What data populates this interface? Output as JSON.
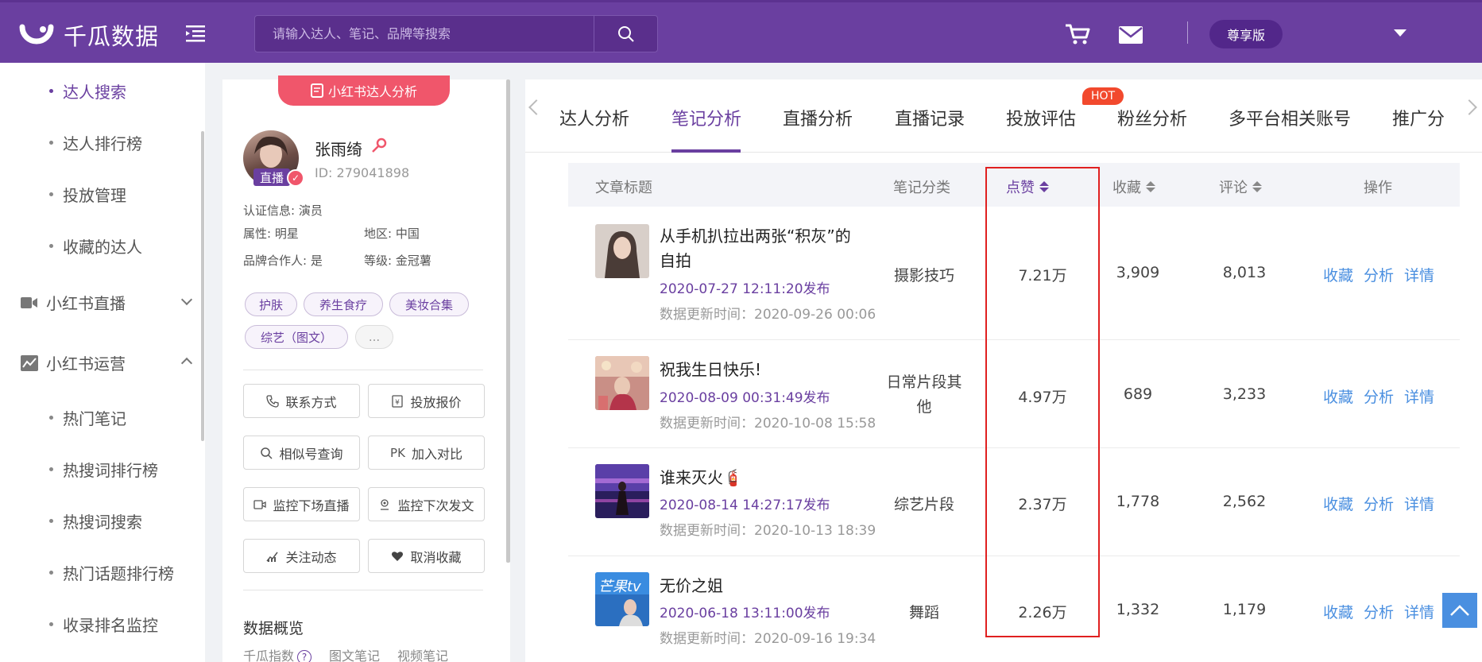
{
  "brand": {
    "name": "千瓜数据"
  },
  "search": {
    "placeholder": "请输入达人、笔记、品牌等搜索"
  },
  "header": {
    "plan_label": "尊享版"
  },
  "sidenav": {
    "sub_items_top": [
      "达人搜索",
      "达人排行榜",
      "投放管理",
      "收藏的达人"
    ],
    "group_live": "小红书直播",
    "group_ops": "小红书运营",
    "sub_items_ops": [
      "热门笔记",
      "热搜词排行榜",
      "热搜词搜索",
      "热门话题排行榜",
      "收录排名监控"
    ]
  },
  "profile": {
    "badge": "小红书达人分析",
    "live_tag": "直播",
    "name": "张雨绮",
    "id": "ID: 279041898",
    "cert": "认证信息: 演员",
    "attr": "属性: 明星",
    "region": "地区: 中国",
    "brand_partner": "品牌合作人: 是",
    "level": "等级: 金冠薯",
    "tags": [
      "护肤",
      "养生食疗",
      "美妆合集",
      "综艺（图文）",
      "..."
    ],
    "actions": [
      "联系方式",
      "投放报价",
      "相似号查询",
      "加入对比",
      "监控下场直播",
      "监控下次发文",
      "关注动态",
      "取消收藏"
    ],
    "section_title": "数据概览",
    "sub_tabs": [
      "千瓜指数",
      "图文笔记",
      "视频笔记"
    ]
  },
  "tabs": {
    "items": [
      "达人分析",
      "笔记分析",
      "直播分析",
      "直播记录",
      "投放评估",
      "粉丝分析",
      "多平台相关账号",
      "推广分"
    ],
    "hot": "HOT"
  },
  "table": {
    "headers": [
      "文章标题",
      "笔记分类",
      "点赞",
      "收藏",
      "评论",
      "操作"
    ],
    "rows": [
      {
        "title_line1": "从手机扒拉出两张“积灰”的",
        "title_line2": "自拍",
        "date": "2020-07-27 12:11:20发布",
        "updated": "数据更新时间：2020-09-26 00:06",
        "category_line1": "摄影技巧",
        "category_line2": "",
        "likes": "7.21万",
        "favorites": "3,909",
        "comments": "8,013"
      },
      {
        "title_line1": "祝我生日快乐!",
        "title_line2": "",
        "date": "2020-08-09 00:31:49发布",
        "updated": "数据更新时间：2020-10-08 15:58",
        "category_line1": "日常片段其",
        "category_line2": "他",
        "likes": "4.97万",
        "favorites": "689",
        "comments": "3,233"
      },
      {
        "title_line1": "谁来灭火🧯",
        "title_line2": "",
        "date": "2020-08-14 14:27:17发布",
        "updated": "数据更新时间：2020-10-13 18:39",
        "category_line1": "综艺片段",
        "category_line2": "",
        "likes": "2.37万",
        "favorites": "1,778",
        "comments": "2,562"
      },
      {
        "title_line1": "无价之姐",
        "title_line2": "",
        "date": "2020-06-18 13:11:00发布",
        "updated": "数据更新时间：2020-09-16 19:34",
        "category_line1": "舞蹈",
        "category_line2": "",
        "likes": "2.26万",
        "favorites": "1,332",
        "comments": "1,179"
      }
    ],
    "ops": [
      "收藏",
      "分析",
      "详情"
    ]
  },
  "colors": {
    "brand": "#6a3fa0",
    "accent_red": "#f0566b",
    "link": "#4a8fe0"
  }
}
